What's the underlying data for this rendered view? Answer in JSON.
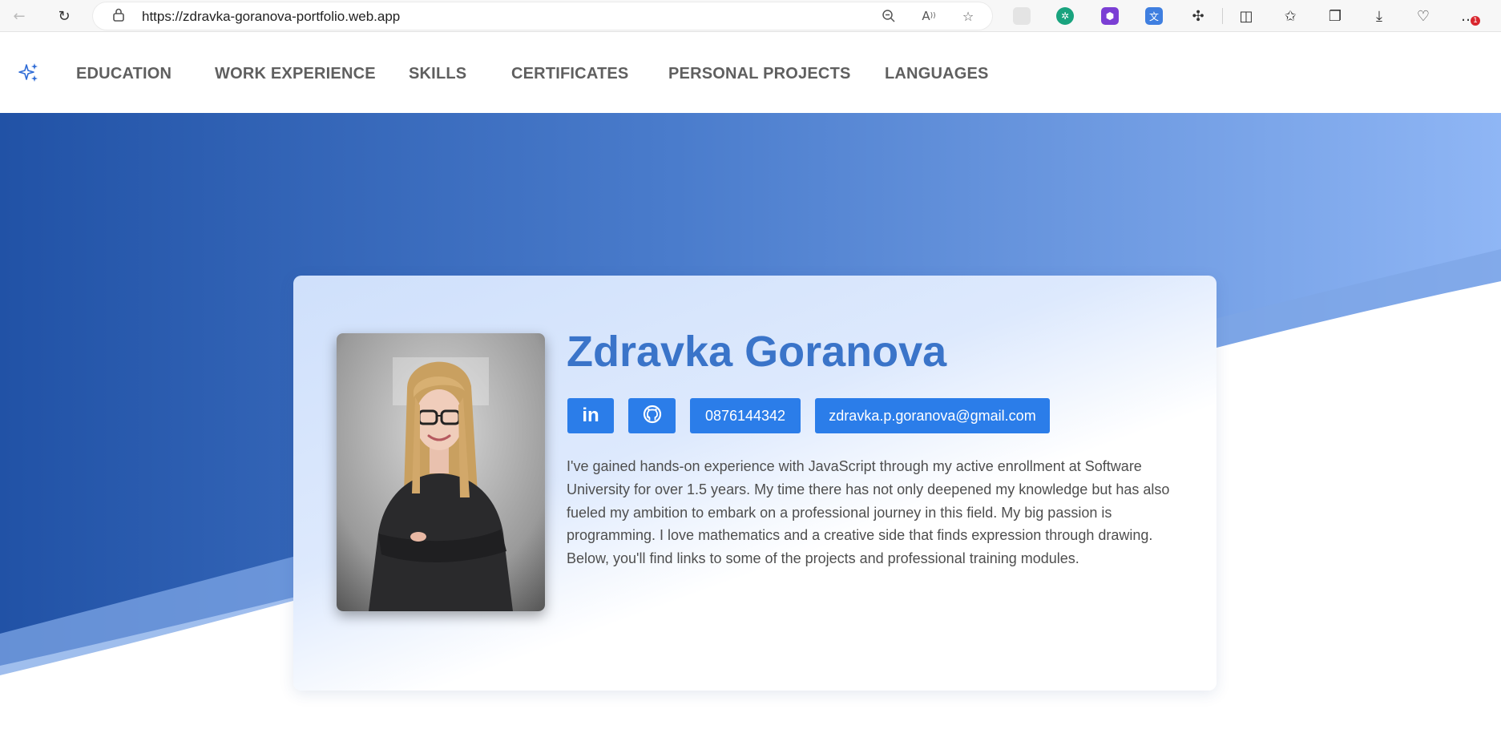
{
  "browser": {
    "url": "https://zdravka-goranova-portfolio.web.app",
    "notification_count": "1"
  },
  "nav": {
    "items": [
      {
        "label": "EDUCATION"
      },
      {
        "label": "WORK EXPERIENCE"
      },
      {
        "label": "SKILLS"
      },
      {
        "label": "CERTIFICATES"
      },
      {
        "label": "PERSONAL PROJECTS"
      },
      {
        "label": "LANGUAGES"
      }
    ]
  },
  "profile": {
    "name": "Zdravka Goranova",
    "phone": "0876144342",
    "email": "zdravka.p.goranova@gmail.com",
    "bio": "I've gained hands-on experience with JavaScript through my active enrollment at Software University for over 1.5 years. My time there has not only deepened my knowledge but has also fueled my ambition to embark on a professional journey in this field. My big passion is programming. I love mathematics and a creative side that finds expression through drawing. Below, you'll find links to some of the projects and professional training modules."
  },
  "colors": {
    "accent": "#2b7de9",
    "name": "#3a74c9",
    "hero_dark": "#2152a6",
    "hero_light": "#8fb6f5"
  },
  "icons": {
    "logo": "sparkles-icon",
    "linkedin": "linkedin-icon",
    "github": "github-icon"
  }
}
